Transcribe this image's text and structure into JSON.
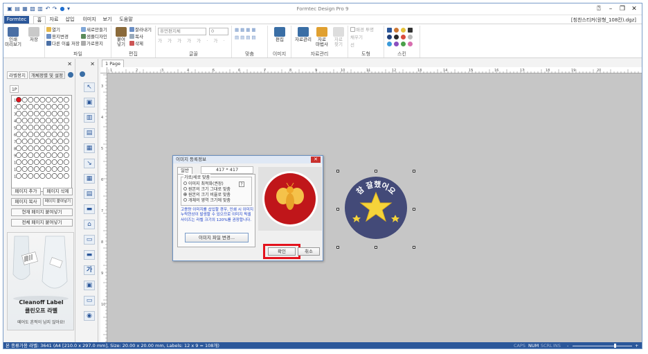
{
  "window": {
    "title": "Formtec Design Pro 9",
    "filename": "[칭찬스티커(원형_108칸).dgz]"
  },
  "ribbon_tabs": [
    "Formtec",
    "홈",
    "자료",
    "삽입",
    "이미지",
    "보기",
    "도움말"
  ],
  "ribbon": {
    "print": {
      "label": "인쇄\n미리보기"
    },
    "save": {
      "label": "저장"
    },
    "file_group": {
      "label": "파일",
      "items": [
        "열기",
        "용지변경",
        "다른 이름 저장",
        "새로만들기",
        "샘플디자인",
        "가로용지"
      ]
    },
    "edit_group": {
      "label": "편집",
      "paste": "붙여\n넣기",
      "items": [
        "잘라내기",
        "복사",
        "삭제"
      ]
    },
    "font_group": {
      "label": "글꼴",
      "font_name": "휴먼편지체",
      "font_size": "0"
    },
    "align_group": {
      "label": "맞춤"
    },
    "image_group": {
      "label": "이미지",
      "edit": "편집"
    },
    "data_group": {
      "label": "자료관리",
      "items": [
        "자료관리",
        "자료\n마법사",
        "자료\n찾기"
      ]
    },
    "shape_group": {
      "label": "도형",
      "bg_fill": "배경 투명",
      "fill": "채우기",
      "line": "선"
    },
    "skin_group": {
      "label": "스킨"
    }
  },
  "left_panel": {
    "tabs": [
      "라벨용지",
      "개체정렬 및 설정"
    ],
    "page_tab": "1P",
    "row_numbers": [
      "1",
      "2",
      "3",
      "4",
      "5",
      "6",
      "7",
      "8",
      "9",
      "10",
      "11",
      "12"
    ],
    "buttons": [
      "페이지 추가",
      "페이지 삭제",
      "페이지 복사",
      "페이지 붙여넣기",
      "현재 페이지 붙여넣기",
      "전체 페이지 붙여넣기"
    ],
    "ad": {
      "title": "Cleanoff Label",
      "subtitle": "클린오프 라벨",
      "caption": "떼어도 흔적이 남지 않아요!"
    }
  },
  "doc_tab": "1 Page",
  "ruler": {
    "h_ticks": [
      "1",
      "2",
      "3",
      "4",
      "5",
      "6",
      "7",
      "8",
      "9",
      "10",
      "11",
      "12",
      "13",
      "14",
      "15",
      "16",
      "17",
      "18",
      "19",
      "20"
    ],
    "v_ticks": [
      "3",
      "4",
      "5",
      "6",
      "7",
      "8",
      "9",
      "10"
    ]
  },
  "sticker": {
    "text": "참 잘했어요",
    "bg_color": "#434a78",
    "star_color": "#f5d33a"
  },
  "dialog": {
    "title": "이미지 등록정보",
    "tab": "일반",
    "size": "417 * 417",
    "section": "가로/세로 맞춤",
    "options": [
      "이미지 최적화(권장)",
      "원본의 크기 그대로 맞춤",
      "원본의 크기 비율로 맞춤",
      "개체의 영역 크기에 맞춤"
    ],
    "selected_option": 2,
    "help_icon": "?",
    "notice": "고용량 이미지를 삽입할 경우, 인쇄 시 이미지 누락현상이 발생할 수 있으므로 이미지 픽셀사이즈는 라벨 크기의 120%를 권장합니다.",
    "change_image": "이미지 파일 변경...",
    "ok": "확인",
    "cancel": "취소",
    "preview_colors": {
      "bg": "#c0161a",
      "bee": "#f5c24a"
    },
    "highlight_color": "#e3121c"
  },
  "status": {
    "text": "본 종류가용 라벨: 3641 (A4 [210.0 x 297.0 mm], Size: 20.00 x 20.00 mm,  Labels: 12 x 9 = 108개)",
    "indicators": [
      "CAPS",
      "NUM",
      "SCRL",
      "INS"
    ],
    "zoom_minus": "-",
    "zoom_plus": "+"
  }
}
